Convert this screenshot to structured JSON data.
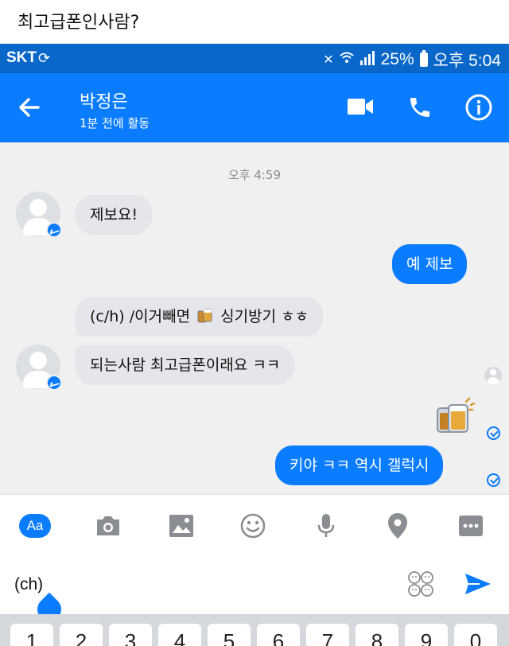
{
  "post": {
    "title": "최고급폰인사람?"
  },
  "status_bar": {
    "carrier": "SKT",
    "battery": "25%",
    "time": "오후 5:04"
  },
  "header": {
    "contact_name": "박정은",
    "active_status": "1분 전에 활동"
  },
  "chat": {
    "timestamp": "오후 4:59",
    "messages": [
      {
        "from": "them",
        "text": "제보요!"
      },
      {
        "from": "me",
        "text": "예 제보"
      },
      {
        "from": "them",
        "text_before": "(c/h) /이거빼면",
        "text_after": "싱기방기 ㅎㅎ"
      },
      {
        "from": "them",
        "text": "되는사람 최고급폰이래요 ㅋㅋ"
      },
      {
        "from": "me",
        "sticker": "beer-mug"
      },
      {
        "from": "me",
        "text": "키야 ㅋㅋ 역시 갤럭시"
      }
    ]
  },
  "toolbar": {
    "aa_label": "Aa"
  },
  "composer": {
    "value": "(ch)"
  },
  "keyboard": {
    "keys": [
      "1",
      "2",
      "3",
      "4",
      "5",
      "6",
      "7",
      "8",
      "9",
      "0"
    ]
  },
  "colors": {
    "messenger_blue": "#0a7cff",
    "status_bar": "#0867c9",
    "incoming_bubble": "#e4e6eb"
  }
}
